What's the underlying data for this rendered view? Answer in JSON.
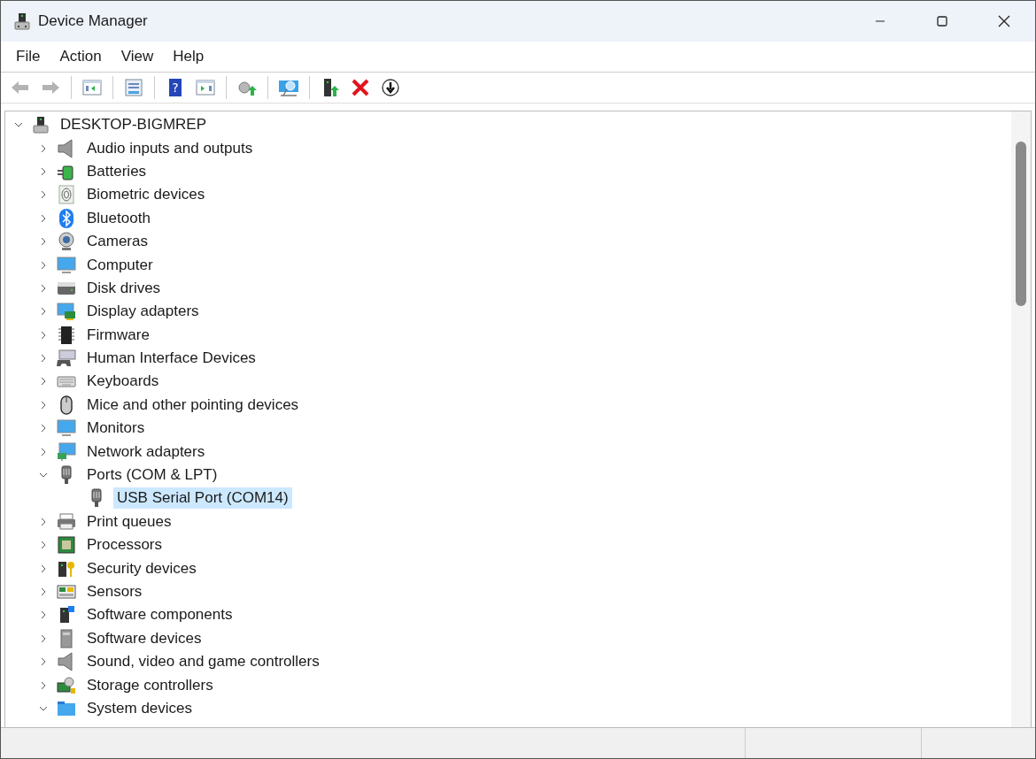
{
  "window": {
    "title": "Device Manager"
  },
  "menu": [
    "File",
    "Action",
    "View",
    "Help"
  ],
  "toolbar": {
    "groups": [
      [
        {
          "disabled": true
        },
        {
          "disabled": true
        }
      ],
      [
        {
          "disabled": false
        }
      ],
      [
        {
          "disabled": false
        }
      ],
      [
        {
          "disabled": false,
          "glyph": "?"
        },
        {
          "disabled": false
        }
      ],
      [
        {
          "disabled": false
        }
      ],
      [
        {
          "disabled": false
        }
      ],
      [
        {
          "disabled": false
        },
        {
          "disabled": false
        },
        {
          "disabled": false
        }
      ]
    ]
  },
  "tree": {
    "root": {
      "label": "DESKTOP-BIGMREP",
      "expanded": true,
      "selected": false
    },
    "items": [
      {
        "label": "Audio inputs and outputs",
        "expanded": false,
        "selected": false
      },
      {
        "label": "Batteries",
        "expanded": false,
        "selected": false
      },
      {
        "label": "Biometric devices",
        "expanded": false,
        "selected": false
      },
      {
        "label": "Bluetooth",
        "expanded": false,
        "selected": false
      },
      {
        "label": "Cameras",
        "expanded": false,
        "selected": false
      },
      {
        "label": "Computer",
        "expanded": false,
        "selected": false
      },
      {
        "label": "Disk drives",
        "expanded": false,
        "selected": false
      },
      {
        "label": "Display adapters",
        "expanded": false,
        "selected": false
      },
      {
        "label": "Firmware",
        "expanded": false,
        "selected": false
      },
      {
        "label": "Human Interface Devices",
        "expanded": false,
        "selected": false
      },
      {
        "label": "Keyboards",
        "expanded": false,
        "selected": false
      },
      {
        "label": "Mice and other pointing devices",
        "expanded": false,
        "selected": false
      },
      {
        "label": "Monitors",
        "expanded": false,
        "selected": false
      },
      {
        "label": "Network adapters",
        "expanded": false,
        "selected": false
      },
      {
        "label": "Ports (COM & LPT)",
        "expanded": true,
        "selected": false,
        "children": [
          {
            "label": "USB Serial Port (COM14)",
            "selected": true
          }
        ]
      },
      {
        "label": "Print queues",
        "expanded": false,
        "selected": false
      },
      {
        "label": "Processors",
        "expanded": false,
        "selected": false
      },
      {
        "label": "Security devices",
        "expanded": false,
        "selected": false
      },
      {
        "label": "Sensors",
        "expanded": false,
        "selected": false
      },
      {
        "label": "Software components",
        "expanded": false,
        "selected": false
      },
      {
        "label": "Software devices",
        "expanded": false,
        "selected": false
      },
      {
        "label": "Sound, video and game controllers",
        "expanded": false,
        "selected": false
      },
      {
        "label": "Storage controllers",
        "expanded": false,
        "selected": false
      },
      {
        "label": "System devices",
        "expanded": true,
        "selected": false
      }
    ]
  }
}
